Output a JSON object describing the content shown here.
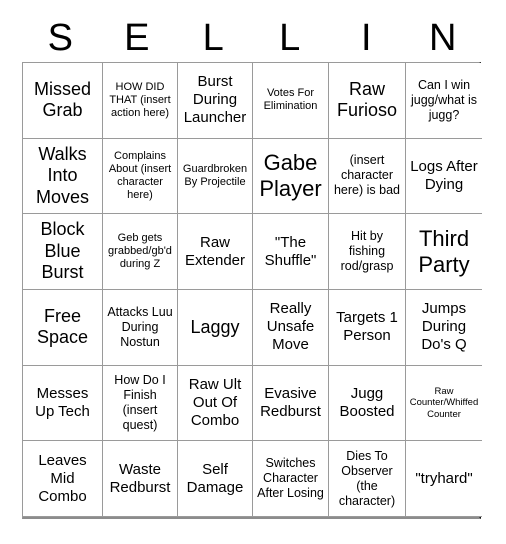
{
  "card": {
    "header_letters": [
      "S",
      "E",
      "L",
      "L",
      "I",
      "N"
    ],
    "columns": 6,
    "rows": 6,
    "background_color": "#ffffff",
    "text_color": "#000000",
    "grid_line_color": "#9a9a9a",
    "cells": [
      {
        "text": "Missed Grab",
        "size": "xl"
      },
      {
        "text": "HOW DID THAT (insert action here)",
        "size": "s"
      },
      {
        "text": "Burst During Launcher",
        "size": "l"
      },
      {
        "text": "Votes For Elimination",
        "size": "s"
      },
      {
        "text": "Raw Furioso",
        "size": "xl"
      },
      {
        "text": "Can I win jugg/what is jugg?",
        "size": "m"
      },
      {
        "text": "Walks Into Moves",
        "size": "xl"
      },
      {
        "text": "Complains About (insert character here)",
        "size": "s"
      },
      {
        "text": "Guardbroken By Projectile",
        "size": "s"
      },
      {
        "text": "Gabe Player",
        "size": "xxl"
      },
      {
        "text": "(insert character here) is bad",
        "size": "m"
      },
      {
        "text": "Logs After Dying",
        "size": "l"
      },
      {
        "text": "Block Blue Burst",
        "size": "xl"
      },
      {
        "text": "Geb gets grabbed/gb'd during Z",
        "size": "s"
      },
      {
        "text": "Raw Extender",
        "size": "l"
      },
      {
        "text": "\"The Shuffle\"",
        "size": "l"
      },
      {
        "text": "Hit by fishing rod/grasp",
        "size": "m"
      },
      {
        "text": "Third Party",
        "size": "xxl"
      },
      {
        "text": "Free Space",
        "size": "xl"
      },
      {
        "text": "Attacks Luu During Nostun",
        "size": "m"
      },
      {
        "text": "Laggy",
        "size": "xl"
      },
      {
        "text": "Really Unsafe Move",
        "size": "l"
      },
      {
        "text": "Targets 1 Person",
        "size": "l"
      },
      {
        "text": "Jumps During Do's Q",
        "size": "l"
      },
      {
        "text": "Messes Up Tech",
        "size": "l"
      },
      {
        "text": "How Do I Finish (insert quest)",
        "size": "m"
      },
      {
        "text": "Raw Ult Out Of Combo",
        "size": "l"
      },
      {
        "text": "Evasive Redburst",
        "size": "l"
      },
      {
        "text": "Jugg Boosted",
        "size": "l"
      },
      {
        "text": "Raw Counter/Whiffed Counter",
        "size": "xs"
      },
      {
        "text": "Leaves Mid Combo",
        "size": "l"
      },
      {
        "text": "Waste Redburst",
        "size": "l"
      },
      {
        "text": "Self Damage",
        "size": "l"
      },
      {
        "text": "Switches Character After Losing",
        "size": "m"
      },
      {
        "text": "Dies To Observer (the character)",
        "size": "m"
      },
      {
        "text": "\"tryhard\"",
        "size": "l"
      }
    ]
  }
}
